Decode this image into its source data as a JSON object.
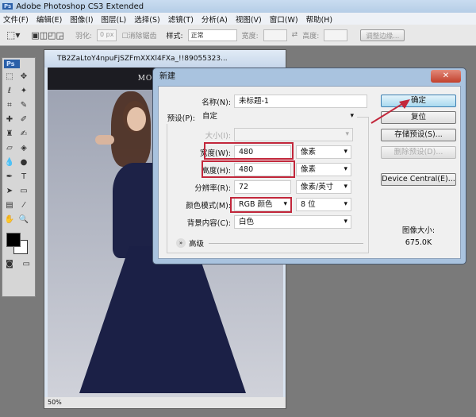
{
  "app": {
    "title": "Adobe Photoshop CS3 Extended",
    "logo": "Ps"
  },
  "menu": [
    "文件(F)",
    "编辑(E)",
    "图像(I)",
    "图层(L)",
    "选择(S)",
    "滤镜(T)",
    "分析(A)",
    "视图(V)",
    "窗口(W)",
    "帮助(H)"
  ],
  "options": {
    "feather_label": "羽化:",
    "feather_value": "0 px",
    "antialias_label": "消除锯齿",
    "style_label": "样式:",
    "style_value": "正常",
    "width_label": "宽度:",
    "height_label": "高度:",
    "refine_label": "调整边缘..."
  },
  "document": {
    "title": "TB2ZaLtoY4npuFjSZFmXXXl4FXa_!!89055323...",
    "banner": "MODEL SHO",
    "zoom": "50%"
  },
  "dialog": {
    "title": "新建",
    "close": "✕",
    "name_label": "名称(N):",
    "name_value": "未标题-1",
    "preset_label": "预设(P):",
    "preset_value": "自定",
    "size_label": "大小(I):",
    "width_label": "宽度(W):",
    "width_value": "480",
    "width_unit": "像素",
    "height_label": "高度(H):",
    "height_value": "480",
    "height_unit": "像素",
    "resolution_label": "分辨率(R):",
    "resolution_value": "72",
    "resolution_unit": "像素/英寸",
    "color_mode_label": "颜色模式(M):",
    "color_mode_value": "RGB 颜色",
    "bit_depth": "8 位",
    "background_label": "背景内容(C):",
    "background_value": "白色",
    "advanced_label": "高级",
    "ok": "确定",
    "reset": "复位",
    "save_preset": "存储预设(S)...",
    "delete_preset": "删除预设(D)...",
    "device_central": "Device Central(E)...",
    "image_size_label": "图像大小:",
    "image_size_value": "675.0K"
  },
  "colors": {
    "highlight": "#c2273b",
    "dialog_frame": "#a9c3df"
  }
}
